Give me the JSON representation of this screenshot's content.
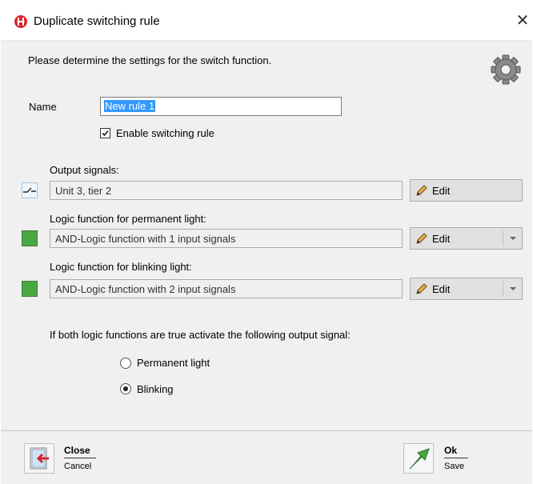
{
  "window": {
    "title": "Duplicate switching rule",
    "close_icon": "close-icon",
    "app_icon": "app-logo-icon"
  },
  "intro": "Please determine the settings for the switch function.",
  "settings_icon": "gear-icon",
  "name": {
    "label": "Name",
    "value": "New rule 1"
  },
  "enable": {
    "label": "Enable switching rule",
    "checked": true
  },
  "output_signals": {
    "label": "Output signals:",
    "value": "Unit 3, tier 2",
    "icon": "signal-switch-icon",
    "button": "Edit"
  },
  "permanent_light": {
    "label": "Logic function for permanent light:",
    "value": "AND-Logic function with 1 input signals",
    "status_color": "#4aa840",
    "button": "Edit"
  },
  "blinking_light": {
    "label": "Logic function for blinking light:",
    "value": "AND-Logic function with 2 input signals",
    "status_color": "#4aa840",
    "button": "Edit"
  },
  "activate": {
    "question": "If both logic functions are true activate the following output signal:",
    "options": [
      "Permanent light",
      "Blinking"
    ],
    "selected": "Blinking"
  },
  "footer": {
    "close": {
      "label": "Close",
      "sublabel": "Cancel",
      "icon": "close-dialog-icon"
    },
    "ok": {
      "label": "Ok",
      "sublabel": "Save",
      "icon": "ok-arrow-icon"
    }
  }
}
